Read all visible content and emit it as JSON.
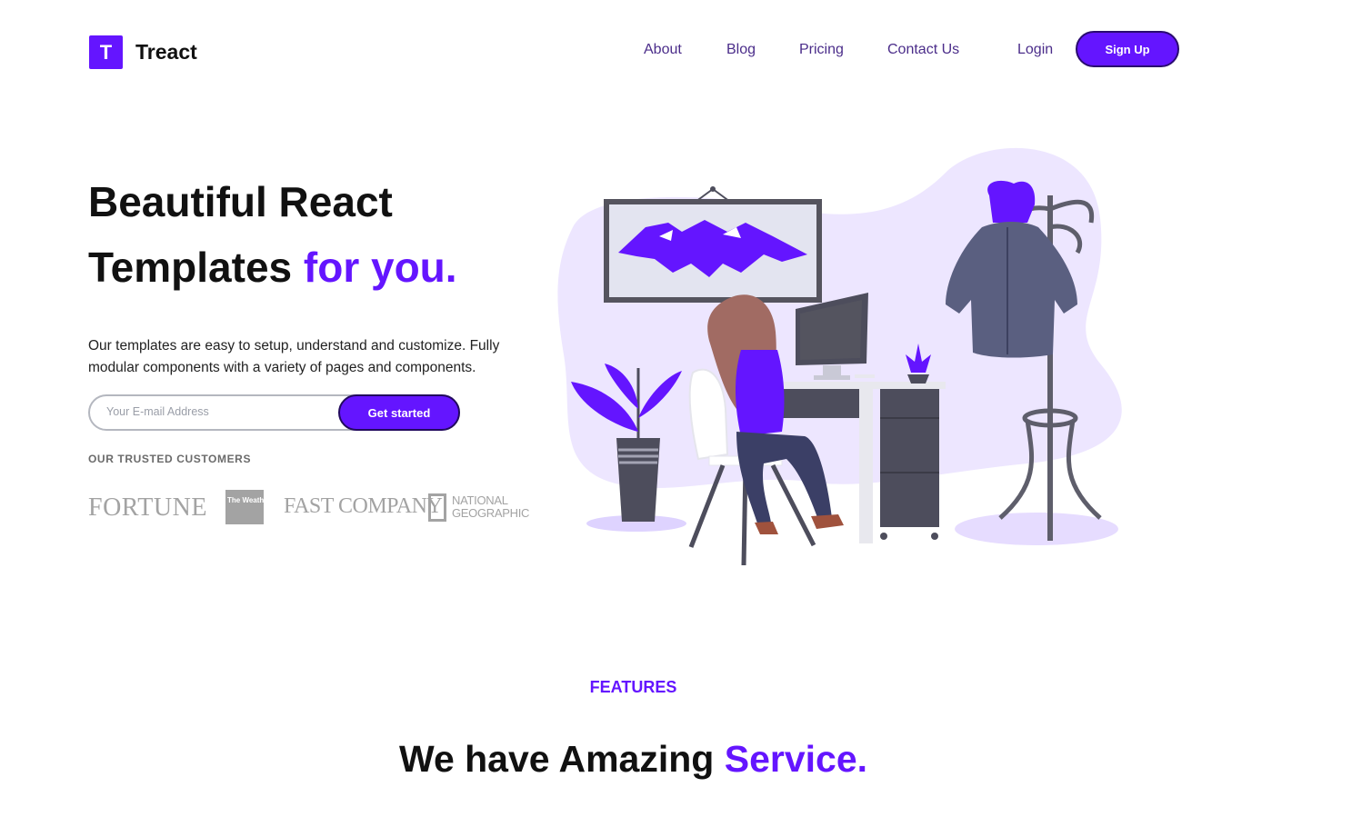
{
  "brand": {
    "logo_letter": "T",
    "name": "Treact"
  },
  "nav": {
    "links": [
      "About",
      "Blog",
      "Pricing",
      "Contact Us"
    ],
    "login": "Login",
    "signup": "Sign Up"
  },
  "hero": {
    "headline_line1": "Beautiful React",
    "headline_line2": "Templates",
    "headline_accent": "for you.",
    "description": "Our templates are easy to setup, understand and customize. Fully modular components with a variety of pages and components.",
    "email_placeholder": "Your E-mail Address",
    "cta_label": "Get started"
  },
  "customers": {
    "heading": "OUR TRUSTED CUSTOMERS",
    "logos": [
      "FORTUNE",
      "The Weather Channel",
      "FAST COMPANY",
      "NATIONAL GEOGRAPHIC"
    ]
  },
  "features": {
    "label": "FEATURES",
    "heading": "We have Amazing",
    "heading_accent": "Service."
  },
  "colors": {
    "accent": "#6415ff",
    "text": "#111111",
    "nav_text": "#4b2d8a",
    "muted": "#a3a3a3"
  }
}
